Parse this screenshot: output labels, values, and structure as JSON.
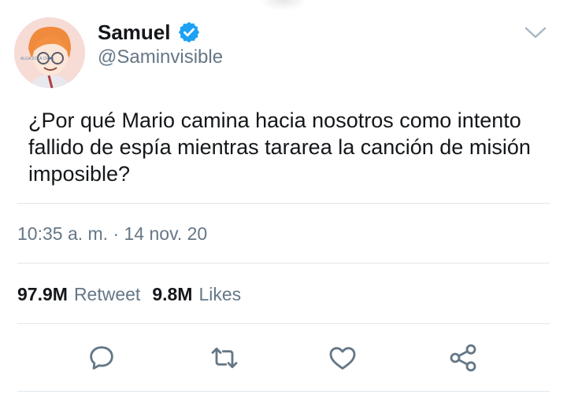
{
  "user": {
    "name": "Samuel",
    "handle": "@Saminvisible",
    "avatar_icon": "avatar-illustration",
    "avatar_caption": "ALGA ZOLA CREA"
  },
  "tweet": {
    "text": "¿Por qué Mario camina hacia nosotros como intento fallido de espía mientras tararea la canción de misión imposible?",
    "timestamp": "10:35 a. m. · 14 nov. 20"
  },
  "stats": {
    "retweets_count": "97.9M",
    "retweets_label": "Retweet",
    "likes_count": "9.8M",
    "likes_label": "Likes"
  },
  "actions": [
    "reply-icon",
    "retweet-icon",
    "like-icon",
    "share-icon"
  ],
  "colors": {
    "text": "#14171a",
    "secondary": "#657786",
    "verified_blue": "#1da1f2",
    "divider": "#e1e8ed"
  }
}
